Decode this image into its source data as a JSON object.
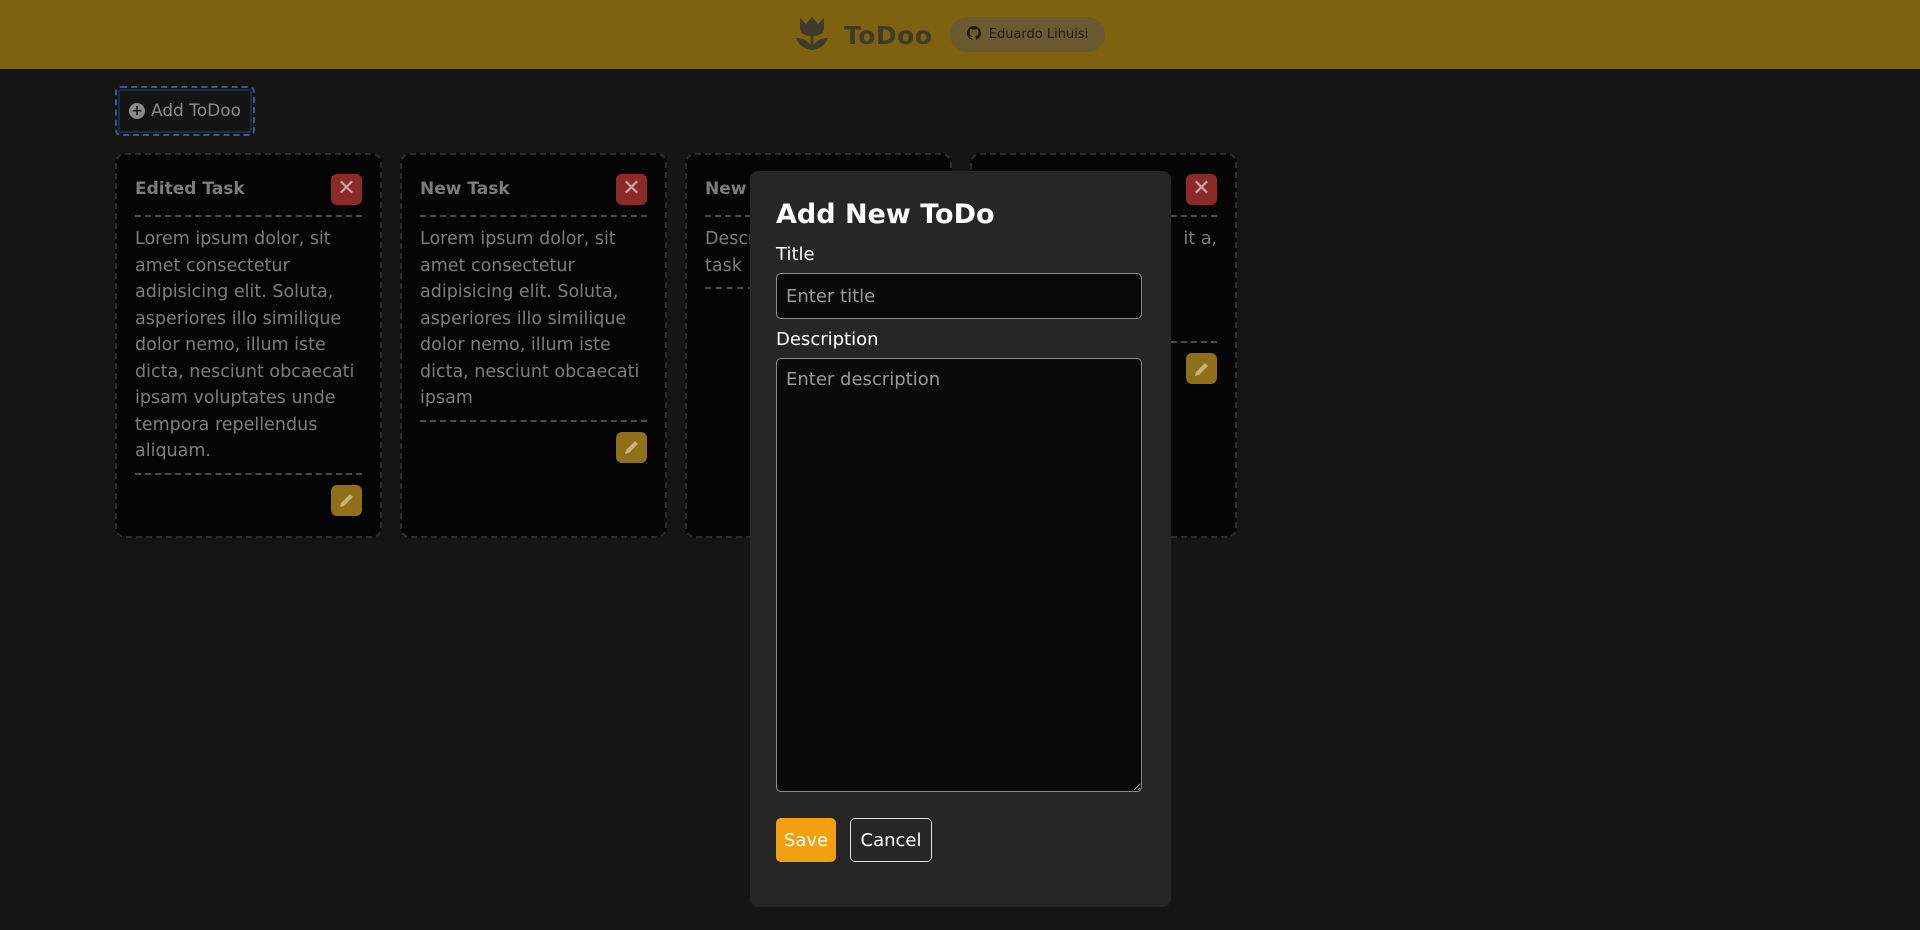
{
  "header": {
    "brand": "ToDoo",
    "github_label": "Eduardo Lihuisi"
  },
  "toolbar": {
    "add_label": "Add ToDoo"
  },
  "cards": [
    {
      "title": "Edited Task",
      "description": "Lorem ipsum dolor, sit amet consectetur adipisicing elit. Soluta, asperiores illo similique dolor nemo, illum iste dicta, nesciunt obcaecati ipsam voluptates unde tempora repellendus aliquam."
    },
    {
      "title": "New Task",
      "description": "Lorem ipsum dolor, sit amet consectetur adipisicing elit. Soluta, asperiores illo similique dolor nemo, illum iste dicta, nesciunt obcaecati ipsam"
    },
    {
      "title": "New T",
      "description": "Descr task"
    },
    {
      "title": "",
      "description": "it a,"
    }
  ],
  "modal": {
    "title": "Add New ToDo",
    "title_label": "Title",
    "title_placeholder": "Enter title",
    "description_label": "Description",
    "description_placeholder": "Enter description",
    "save_label": "Save",
    "cancel_label": "Cancel"
  },
  "colors": {
    "header_bg": "#7e6210",
    "accent": "#f0a010",
    "danger": "#8c2a2a"
  }
}
